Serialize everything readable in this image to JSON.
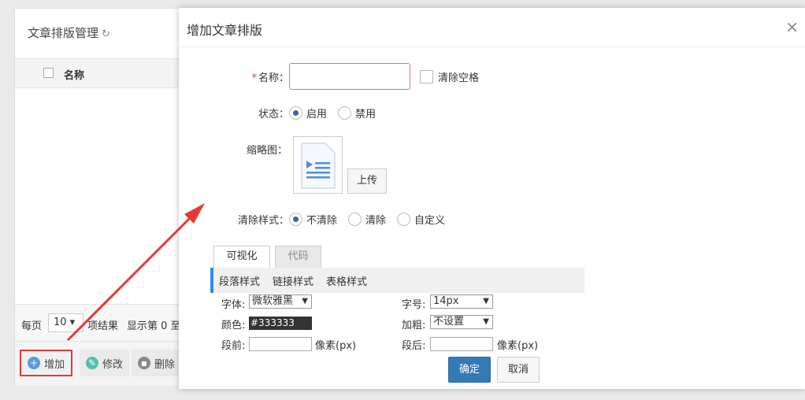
{
  "background": {
    "title": "文章排版管理",
    "column_name": "名称",
    "pager": {
      "per_page_label": "每页",
      "per_page_value": "10",
      "result_text": "项结果",
      "showing_text": "显示第 0 至"
    },
    "toolbar": {
      "add": "增加",
      "edit": "修改",
      "delete": "删除"
    }
  },
  "modal": {
    "title": "增加文章排版",
    "close_symbol": "×",
    "fields": {
      "name_label": "名称：",
      "name_required_mark": "*",
      "trim_spaces": "清除空格",
      "status_label": "状态：",
      "status_options": [
        "启用",
        "禁用"
      ],
      "status_selected": "启用",
      "thumbnail_label": "缩略图：",
      "upload_button": "上传",
      "clear_style_label": "清除样式：",
      "clear_style_options": [
        "不清除",
        "清除",
        "自定义"
      ],
      "clear_style_selected": "不清除"
    },
    "tabs": [
      "可视化",
      "代码"
    ],
    "style_tabs": [
      "段落样式",
      "链接样式",
      "表格样式"
    ],
    "paragraph": {
      "font_label": "字体:",
      "font_value": "微软雅黑",
      "size_label": "字号:",
      "size_value": "14px",
      "color_label": "颜色:",
      "color_value": "#333333",
      "bold_label": "加粗:",
      "bold_value": "不设置",
      "before_label": "段前:",
      "before_unit": "像素(px)",
      "after_label": "段后:",
      "after_unit": "像素(px)"
    },
    "buttons": {
      "ok": "确定",
      "cancel": "取消"
    }
  },
  "colors": {
    "primary": "#337ab7",
    "required": "#e53935",
    "highlight": "#e53935",
    "accent_bar": "#2d8cf0"
  },
  "icons": [
    "refresh-icon",
    "close-icon",
    "add-icon",
    "edit-icon",
    "delete-icon",
    "document-icon",
    "red-arrow"
  ]
}
